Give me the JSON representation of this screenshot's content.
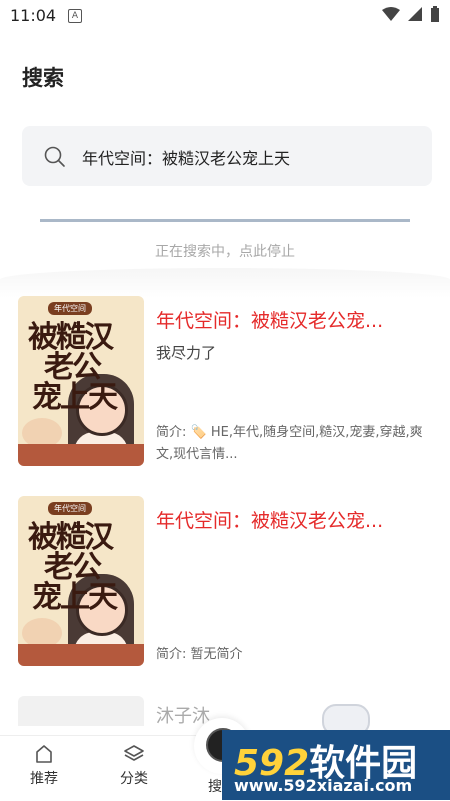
{
  "status_bar": {
    "time": "11:04",
    "a_badge": "A"
  },
  "header": {
    "title": "搜索"
  },
  "search": {
    "query": "年代空间：被糙汉老公宠上天",
    "progress": 1.0
  },
  "status": {
    "searching_text": "正在搜索中，点此停止"
  },
  "results": [
    {
      "title": "年代空间：被糙汉老公宠...",
      "author": "我尽力了",
      "intro": "简介: 🏷️ HE,年代,随身空间,糙汉,宠妻,穿越,爽文,现代言情...",
      "cover_tag": "年代空间",
      "cover_lines": [
        "被糙汉",
        "老公",
        "宠上天"
      ]
    },
    {
      "title": "年代空间：被糙汉老公宠...",
      "author": "",
      "intro": "简介: 暂无简介",
      "cover_tag": "年代空间",
      "cover_lines": [
        "被糙汉",
        "老公",
        "宠上天"
      ]
    }
  ],
  "partial_result": {
    "title_fragment": "沐子沐"
  },
  "bottom_nav": {
    "recommend": "推荐",
    "category": "分类",
    "search": "搜"
  },
  "watermark": {
    "brand_num": "592",
    "brand_cn": "软件园",
    "url": "www.592xiazai.com"
  },
  "colors": {
    "accent_title": "#e52a2a",
    "progress": "#aab8c8",
    "search_bg": "#f3f4f6",
    "watermark_bg": "#1b4f84"
  }
}
